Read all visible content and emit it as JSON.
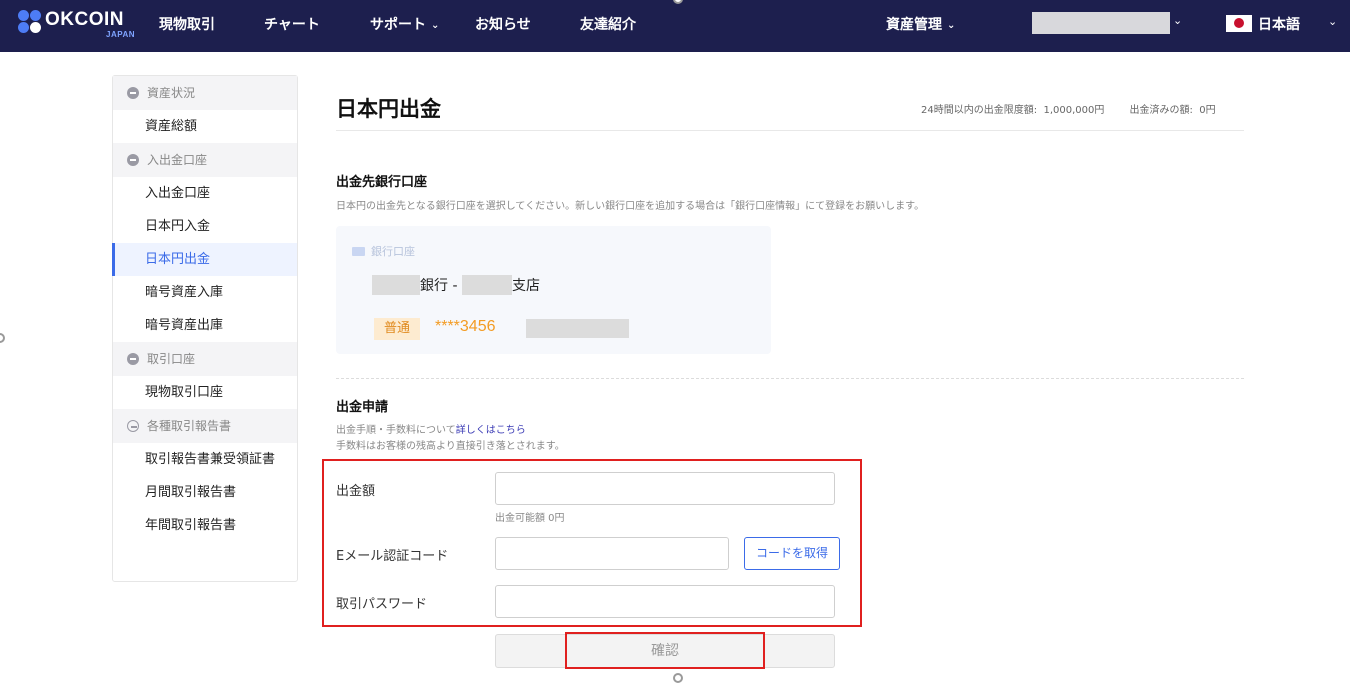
{
  "header": {
    "logo_text": "OKCOIN",
    "logo_sub": "JAPAN",
    "nav": [
      "現物取引",
      "チャート",
      "サポート",
      "お知らせ",
      "友達紹介"
    ],
    "asset_menu": "資産管理",
    "language": "日本語"
  },
  "sidebar": {
    "groups": [
      {
        "label": "資産状況",
        "items": [
          "資産総額"
        ]
      },
      {
        "label": "入出金口座",
        "items": [
          "入出金口座",
          "日本円入金",
          "日本円出金",
          "暗号資産入庫",
          "暗号資産出庫"
        ]
      },
      {
        "label": "取引口座",
        "items": [
          "現物取引口座"
        ]
      },
      {
        "label": "各種取引報告書",
        "items": [
          "取引報告書兼受領証書",
          "月間取引報告書",
          "年間取引報告書"
        ]
      }
    ],
    "active_item": "日本円出金"
  },
  "main": {
    "title": "日本円出金",
    "limit_label": "24時間以内の出金限度額:",
    "limit_value": "1,000,000円",
    "withdrawn_label": "出金済みの額:",
    "withdrawn_value": "0円",
    "bank_section": {
      "title": "出金先銀行口座",
      "desc": "日本円の出金先となる銀行口座を選択してください。新しい銀行口座を追加する場合は「銀行口座情報」にて登録をお願いします。",
      "card_label": "銀行口座",
      "bank_suffix": "銀行 -",
      "branch_suffix": "支店",
      "account_type": "普通",
      "account_number": "****3456"
    },
    "request_section": {
      "title": "出金申請",
      "desc1_prefix": "出金手順・手数料について",
      "desc1_link": "詳しくはこちら",
      "desc2": "手数料はお客様の残高より直接引き落とされます。",
      "amount_label": "出金額",
      "available_hint": "出金可能額 0円",
      "email_code_label": "Eメール認証コード",
      "get_code_button": "コードを取得",
      "password_label": "取引パスワード",
      "confirm_button": "確認"
    }
  }
}
